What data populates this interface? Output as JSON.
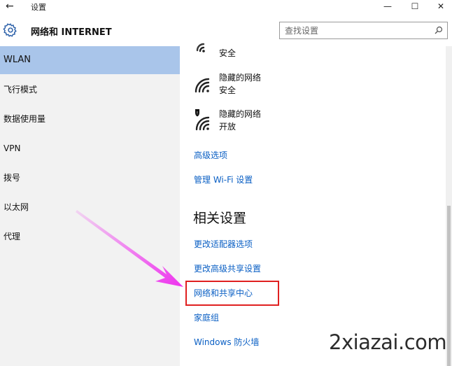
{
  "titlebar": {
    "back_icon": "back-arrow-icon",
    "title": "设置",
    "minimize": "—",
    "maximize": "☐",
    "close": "✕"
  },
  "header": {
    "icon": "gear-icon",
    "title": "网络和 INTERNET",
    "search_placeholder": "查找设置"
  },
  "sidebar": {
    "items": [
      {
        "label": "WLAN",
        "active": true
      },
      {
        "label": "飞行模式"
      },
      {
        "label": "数据使用量"
      },
      {
        "label": "VPN"
      },
      {
        "label": "拨号"
      },
      {
        "label": "以太网"
      },
      {
        "label": "代理"
      }
    ]
  },
  "main": {
    "networks": [
      {
        "name": "",
        "security": "安全"
      },
      {
        "name": "隐藏的网络",
        "security": "安全"
      },
      {
        "name": "隐藏的网络",
        "security": "开放"
      }
    ],
    "links": {
      "advanced": "高级选项",
      "manage_wifi": "管理 Wi-Fi 设置"
    },
    "related": {
      "title": "相关设置",
      "items": [
        "更改适配器选项",
        "更改高级共享设置",
        "网络和共享中心",
        "家庭组",
        "Windows 防火墙"
      ]
    }
  },
  "colors": {
    "accent": "#0a5fc4",
    "sidebar_active": "#a9c5ea",
    "highlight_border": "#e02020",
    "arrow": "#ee33ee"
  },
  "watermark": "2xiazai.com"
}
